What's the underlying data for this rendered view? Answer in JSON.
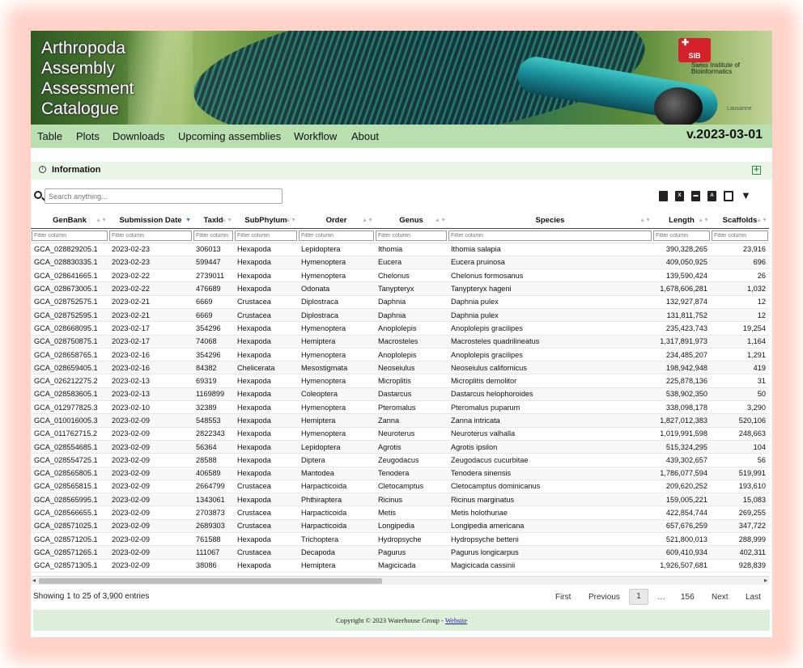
{
  "banner": {
    "title_lines": [
      "Arthropoda",
      "Assembly",
      "Assessment",
      "Catalogue"
    ],
    "sib_logo": "SIB",
    "sib_text": "Swiss Institute of Bioinformatics",
    "sib_location": "Lausanne"
  },
  "nav": {
    "items": [
      "Table",
      "Plots",
      "Downloads",
      "Upcoming assemblies",
      "Workflow",
      "About"
    ],
    "version": "v.2023-03-01"
  },
  "info": {
    "title": "Information",
    "toggle_icon": "plus-square-icon"
  },
  "search": {
    "placeholder": "Search anything..."
  },
  "tools": [
    "copy-icon",
    "excel-icon",
    "csv-icon",
    "pdf-icon",
    "columns-icon",
    "filter-icon"
  ],
  "table": {
    "columns": [
      "GenBank",
      "Submission Date",
      "TaxId",
      "SubPhylum",
      "Order",
      "Genus",
      "Species",
      "Length",
      "Scaffolds"
    ],
    "sorted_column": "Submission Date",
    "filter_placeholder": "Filter column",
    "rows": [
      [
        "GCA_028829205.1",
        "2023-02-23",
        "306013",
        "Hexapoda",
        "Lepidoptera",
        "Ithomia",
        "Ithomia salapia",
        "390,328,265",
        "23,916"
      ],
      [
        "GCA_028830335.1",
        "2023-02-23",
        "599447",
        "Hexapoda",
        "Hymenoptera",
        "Eucera",
        "Eucera pruinosa",
        "409,050,925",
        "696"
      ],
      [
        "GCA_028641665.1",
        "2023-02-22",
        "2739011",
        "Hexapoda",
        "Hymenoptera",
        "Chelonus",
        "Chelonus formosanus",
        "139,590,424",
        "26"
      ],
      [
        "GCA_028673005.1",
        "2023-02-22",
        "476689",
        "Hexapoda",
        "Odonata",
        "Tanypteryx",
        "Tanypteryx hageni",
        "1,678,606,281",
        "1,032"
      ],
      [
        "GCA_028752575.1",
        "2023-02-21",
        "6669",
        "Crustacea",
        "Diplostraca",
        "Daphnia",
        "Daphnia pulex",
        "132,927,874",
        "12"
      ],
      [
        "GCA_028752595.1",
        "2023-02-21",
        "6669",
        "Crustacea",
        "Diplostraca",
        "Daphnia",
        "Daphnia pulex",
        "131,811,752",
        "12"
      ],
      [
        "GCA_028668095.1",
        "2023-02-17",
        "354296",
        "Hexapoda",
        "Hymenoptera",
        "Anoplolepis",
        "Anoplolepis gracilipes",
        "235,423,743",
        "19,254"
      ],
      [
        "GCA_028750875.1",
        "2023-02-17",
        "74068",
        "Hexapoda",
        "Hemiptera",
        "Macrosteles",
        "Macrosteles quadrilineatus",
        "1,317,891,973",
        "1,164"
      ],
      [
        "GCA_028658765.1",
        "2023-02-16",
        "354296",
        "Hexapoda",
        "Hymenoptera",
        "Anoplolepis",
        "Anoplolepis gracilipes",
        "234,485,207",
        "1,291"
      ],
      [
        "GCA_028659405.1",
        "2023-02-16",
        "84382",
        "Chelicerata",
        "Mesostigmata",
        "Neoseiulus",
        "Neoseiulus californicus",
        "198,942,948",
        "419"
      ],
      [
        "GCA_026212275.2",
        "2023-02-13",
        "69319",
        "Hexapoda",
        "Hymenoptera",
        "Microplitis",
        "Microplitis demolitor",
        "225,878,136",
        "31"
      ],
      [
        "GCA_028583605.1",
        "2023-02-13",
        "1169899",
        "Hexapoda",
        "Coleoptera",
        "Dastarcus",
        "Dastarcus helophoroides",
        "538,902,350",
        "50"
      ],
      [
        "GCA_012977825.3",
        "2023-02-10",
        "32389",
        "Hexapoda",
        "Hymenoptera",
        "Pteromalus",
        "Pteromalus puparum",
        "338,098,178",
        "3,290"
      ],
      [
        "GCA_010016005.3",
        "2023-02-09",
        "548553",
        "Hexapoda",
        "Hemiptera",
        "Zanna",
        "Zanna intricata",
        "1,827,012,383",
        "520,106"
      ],
      [
        "GCA_011762715.2",
        "2023-02-09",
        "2822343",
        "Hexapoda",
        "Hymenoptera",
        "Neuroterus",
        "Neuroterus valhalla",
        "1,019,991,598",
        "248,663"
      ],
      [
        "GCA_028554685.1",
        "2023-02-09",
        "56364",
        "Hexapoda",
        "Lepidoptera",
        "Agrotis",
        "Agrotis ipsilon",
        "515,324,295",
        "104"
      ],
      [
        "GCA_028554725.1",
        "2023-02-09",
        "28588",
        "Hexapoda",
        "Diptera",
        "Zeugodacus",
        "Zeugodacus cucurbitae",
        "439,302,657",
        "56"
      ],
      [
        "GCA_028565805.1",
        "2023-02-09",
        "406589",
        "Hexapoda",
        "Mantodea",
        "Tenodera",
        "Tenodera sinensis",
        "1,786,077,594",
        "519,991"
      ],
      [
        "GCA_028565815.1",
        "2023-02-09",
        "2664799",
        "Crustacea",
        "Harpacticoida",
        "Cletocamptus",
        "Cletocamptus dominicanus",
        "209,620,252",
        "193,610"
      ],
      [
        "GCA_028565995.1",
        "2023-02-09",
        "1343061",
        "Hexapoda",
        "Phthiraptera",
        "Ricinus",
        "Ricinus marginatus",
        "159,005,221",
        "15,083"
      ],
      [
        "GCA_028566655.1",
        "2023-02-09",
        "2703873",
        "Crustacea",
        "Harpacticoida",
        "Metis",
        "Metis holothuriae",
        "422,854,744",
        "269,255"
      ],
      [
        "GCA_028571025.1",
        "2023-02-09",
        "2689303",
        "Crustacea",
        "Harpacticoida",
        "Longipedia",
        "Longipedia americana",
        "657,676,259",
        "347,722"
      ],
      [
        "GCA_028571205.1",
        "2023-02-09",
        "761588",
        "Hexapoda",
        "Trichoptera",
        "Hydropsyche",
        "Hydropsyche betteni",
        "521,800,013",
        "288,999"
      ],
      [
        "GCA_028571265.1",
        "2023-02-09",
        "111067",
        "Crustacea",
        "Decapoda",
        "Pagurus",
        "Pagurus longicarpus",
        "609,410,934",
        "402,311"
      ],
      [
        "GCA_028571305.1",
        "2023-02-09",
        "38086",
        "Hexapoda",
        "Hemiptera",
        "Magicicada",
        "Magicicada cassinii",
        "1,926,507,681",
        "928,839"
      ]
    ]
  },
  "footer": {
    "entries": "Showing 1 to 25 of 3,900 entries",
    "pager": {
      "first": "First",
      "previous": "Previous",
      "current": "1",
      "ellipsis": "…",
      "last_page": "156",
      "next": "Next",
      "last": "Last"
    },
    "copyright": "Copyright © 2023 Waterhouse Group - ",
    "website": "Website"
  }
}
